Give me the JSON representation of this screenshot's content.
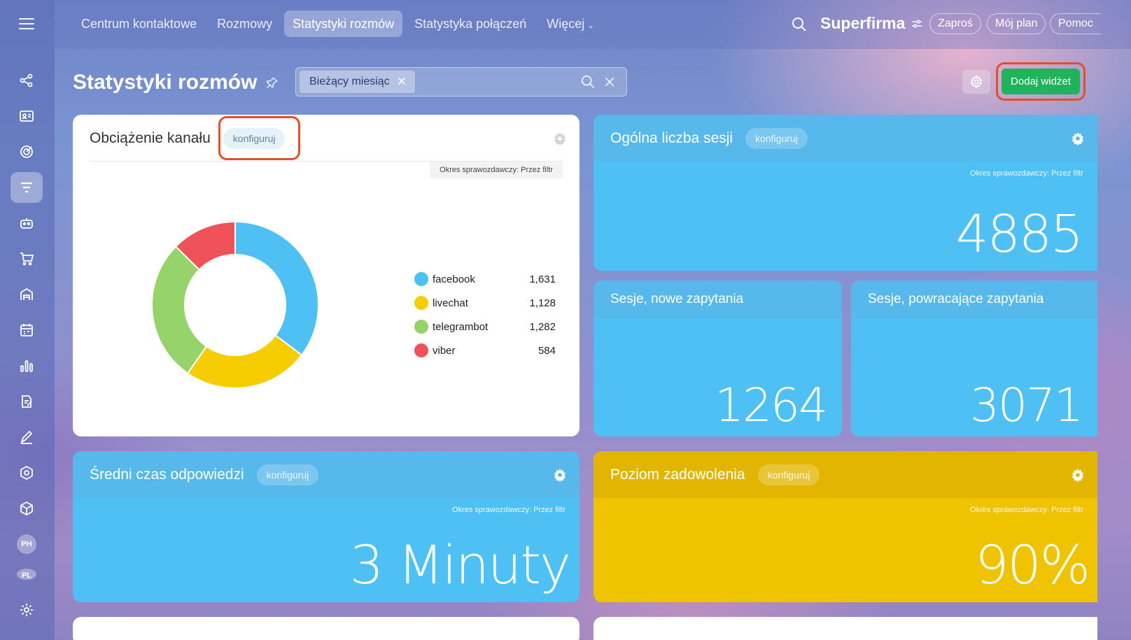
{
  "topnav": {
    "tabs": [
      {
        "label": "Centrum kontaktowe"
      },
      {
        "label": "Rozmowy"
      },
      {
        "label": "Statystyki rozmów"
      },
      {
        "label": "Statystyka połączeń"
      },
      {
        "label": "Więcej"
      }
    ],
    "brand": "Superfirma",
    "invite": "Zaproś",
    "my_plan": "Mój plan",
    "help": "Pomoc"
  },
  "sidebar": {
    "avatars": [
      "PH",
      "PL"
    ]
  },
  "header": {
    "title": "Statystyki rozmów",
    "filter_chip": "Bieżący miesiąc",
    "add_widget": "Dodaj widżet"
  },
  "widgets": {
    "channel_load": {
      "title": "Obciążenie kanału",
      "configure": "konfiguruj",
      "period": "Okres sprawozdawczy: Przez filtr"
    },
    "total_sessions": {
      "title": "Ogólna liczba sesji",
      "configure": "konfiguruj",
      "period": "Okres sprawozdawczy: Przez filtr",
      "value": "4885"
    },
    "new_sessions": {
      "title": "Sesje, nowe zapytania",
      "value": "1264"
    },
    "returning_sessions": {
      "title": "Sesje, powracające zapytania",
      "value": "3071"
    },
    "avg_response": {
      "title": "Średni czas odpowiedzi",
      "configure": "konfiguruj",
      "period": "Okres sprawozdawczy: Przez filtr",
      "value": "3 Minuty"
    },
    "satisfaction": {
      "title": "Poziom zadowolenia",
      "configure": "konfiguruj",
      "period": "Okres sprawozdawczy: Przez filtr",
      "value": "90%"
    }
  },
  "colors": {
    "facebook": "#4fc0f4",
    "livechat": "#f5cd00",
    "telegrambot": "#96d36a",
    "viber": "#f0525a",
    "accent_green": "#1fb35a"
  },
  "chart_data": {
    "type": "pie",
    "categories": [
      "facebook",
      "livechat",
      "telegrambot",
      "viber"
    ],
    "values": [
      1631,
      1128,
      1282,
      584
    ],
    "labels": [
      "1,631",
      "1,128",
      "1,282",
      "584"
    ],
    "donut": true
  }
}
